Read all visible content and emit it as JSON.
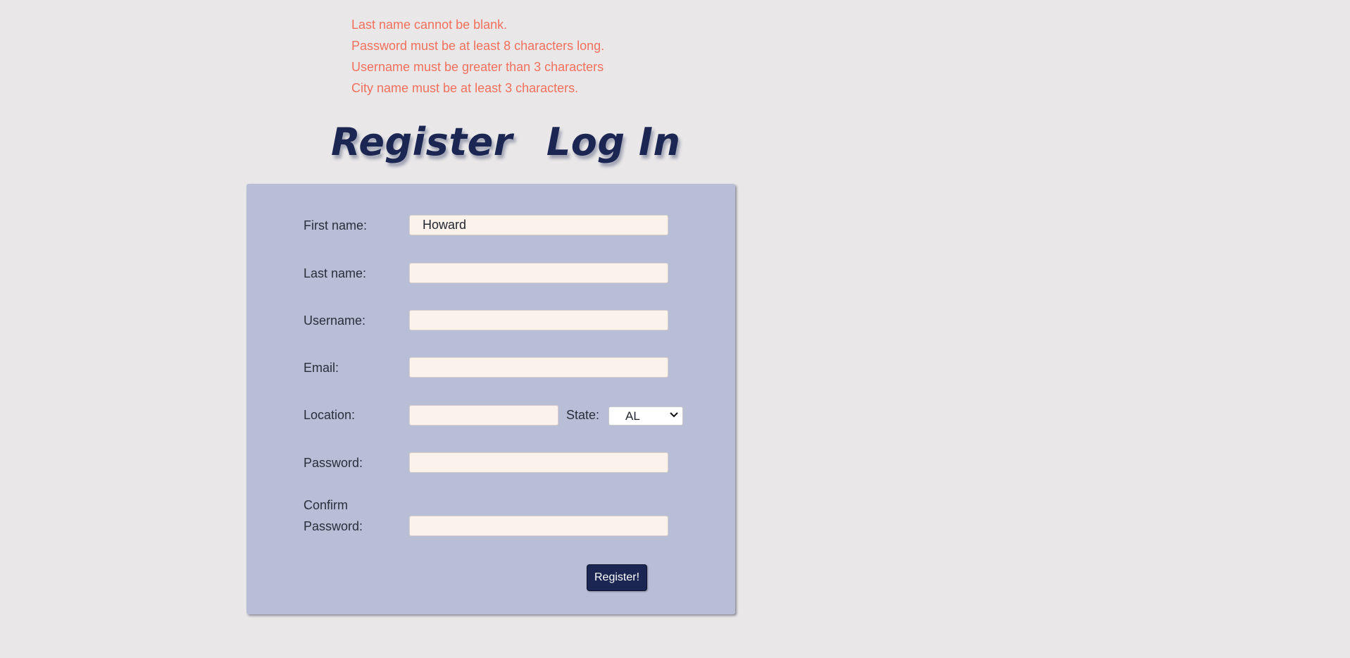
{
  "errors": [
    "Last name cannot be blank.",
    "Password must be at least 8 characters long.",
    "Username must be greater than 3 characters",
    "City name must be at least 3 characters."
  ],
  "tabs": {
    "register": "Register",
    "login": "Log In"
  },
  "form": {
    "first_name": {
      "label": "First name:",
      "value": "Howard"
    },
    "last_name": {
      "label": "Last name:",
      "value": ""
    },
    "username": {
      "label": "Username:",
      "value": ""
    },
    "email": {
      "label": "Email:",
      "value": ""
    },
    "location": {
      "label": "Location:",
      "value": ""
    },
    "state": {
      "label": "State:",
      "selected": "AL"
    },
    "password": {
      "label": "Password:",
      "value": ""
    },
    "confirm_password": {
      "label_line1": "Confirm",
      "label_line2": "Password:",
      "value": ""
    },
    "submit_label": "Register!"
  },
  "colors": {
    "background": "#e9e7e8",
    "panel": "#b8bed5",
    "error_text": "#f2705c",
    "accent": "#1b2653",
    "input_bg": "#fcf2ec"
  }
}
